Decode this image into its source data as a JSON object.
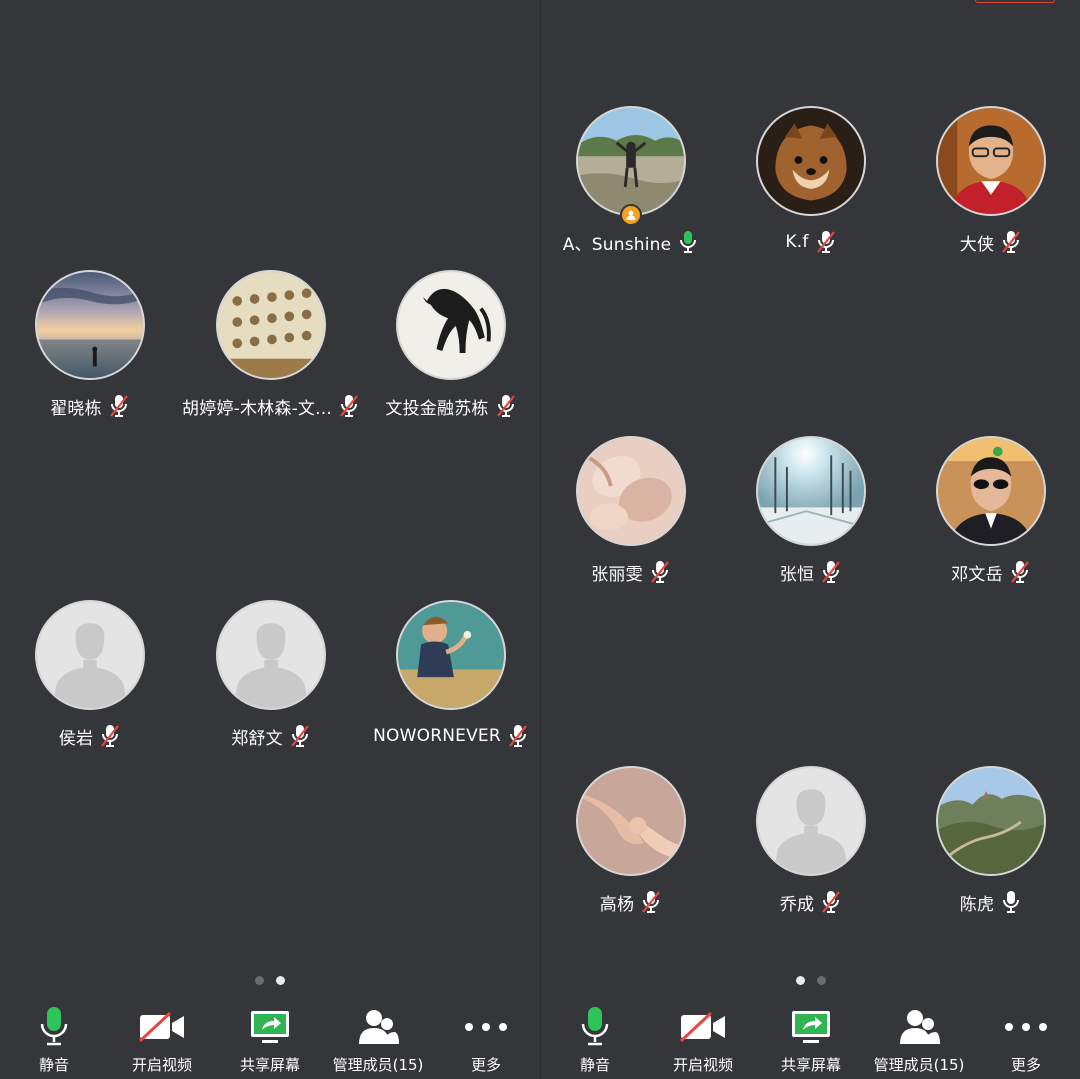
{
  "colors": {
    "background": "#35363a",
    "mic_active": "#2fc45a",
    "mic_muted_slash": "#e8463e",
    "share_green": "#2fb552",
    "host_badge": "#f3a322"
  },
  "left_screen": {
    "participants": [
      {
        "name": "翟晓栋",
        "avatar": "sunset-beach-photo",
        "mic": "muted"
      },
      {
        "name": "胡婷婷-木林森-文...",
        "avatar": "calligraphy-wall-photo",
        "mic": "muted"
      },
      {
        "name": "文投金融苏栋",
        "avatar": "ink-horse-painting",
        "mic": "muted"
      },
      {
        "name": "侯岩",
        "avatar": "default-person",
        "mic": "muted"
      },
      {
        "name": "郑舒文",
        "avatar": "default-person",
        "mic": "muted"
      },
      {
        "name": "NOWORNEVER",
        "avatar": "child-painting",
        "mic": "muted"
      }
    ],
    "page_dots": {
      "count": 2,
      "active_index": 1
    }
  },
  "right_screen": {
    "participants": [
      {
        "name": "A、Sunshine",
        "avatar": "mountain-landscape-person",
        "mic": "speaking",
        "host": true
      },
      {
        "name": "K.f",
        "avatar": "pomeranian-dog-photo",
        "mic": "muted"
      },
      {
        "name": "大侠",
        "avatar": "man-glasses-photo",
        "mic": "muted"
      },
      {
        "name": "张丽雯",
        "avatar": "plush-bunny-photo",
        "mic": "muted"
      },
      {
        "name": "张恒",
        "avatar": "winter-sun-trees-photo",
        "mic": "muted"
      },
      {
        "name": "邓文岳",
        "avatar": "man-sunglasses-photo",
        "mic": "muted"
      },
      {
        "name": "高杨",
        "avatar": "holding-hands-photo",
        "mic": "muted"
      },
      {
        "name": "乔成",
        "avatar": "default-person",
        "mic": "muted"
      },
      {
        "name": "陈虎",
        "avatar": "great-wall-photo",
        "mic": "unmuted"
      }
    ],
    "page_dots": {
      "count": 2,
      "active_index": 0
    }
  },
  "toolbar": {
    "mute": "静音",
    "video": "开启视频",
    "share": "共享屏幕",
    "members": "管理成员(15)",
    "more": "更多"
  }
}
